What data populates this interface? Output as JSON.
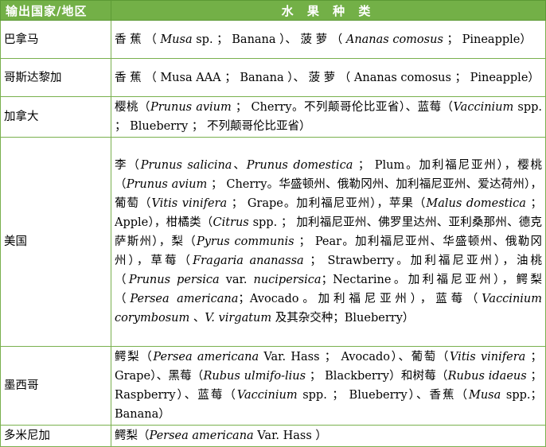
{
  "header": {
    "country_col": "输出国家/地区",
    "fruit_col": "水 果 种 类"
  },
  "rows": [
    {
      "country": "巴拿马",
      "parts": [
        {
          "t": "香 蕉 （ "
        },
        {
          "t": "Musa",
          "i": true
        },
        {
          "t": " sp. ； Banana ）、 菠 萝 （ "
        },
        {
          "t": "Ananas comosus",
          "i": true
        },
        {
          "t": " ； Pineapple）"
        }
      ]
    },
    {
      "country": "哥斯达黎加",
      "parts": [
        {
          "t": "香 蕉 （ Musa AAA ； Banana ）、 菠 萝 （ Ananas comosus ； Pineapple）"
        }
      ]
    },
    {
      "country": "加拿大",
      "parts": [
        {
          "t": "樱桃（"
        },
        {
          "t": "Prunus avium",
          "i": true
        },
        {
          "t": " ； Cherry。不列颠哥伦比亚省）、蓝莓（"
        },
        {
          "t": "Vaccinium",
          "i": true
        },
        {
          "t": " spp. ； Blueberry ； 不列颠哥伦比亚省）"
        }
      ]
    },
    {
      "country": "美国",
      "parts": [
        {
          "t": "李（"
        },
        {
          "t": "Prunus salicina",
          "i": true
        },
        {
          "t": "、"
        },
        {
          "t": "Prunus domestica",
          "i": true
        },
        {
          "t": " ； Plum。加利福尼亚州），樱桃（"
        },
        {
          "t": "Prunus avium",
          "i": true
        },
        {
          "t": " ； Cherry。华盛顿州、俄勒冈州、加利福尼亚州、爱达荷州），葡萄（"
        },
        {
          "t": "Vitis vinifera",
          "i": true
        },
        {
          "t": " ； Grape。加利福尼亚州），苹果（"
        },
        {
          "t": "Malus domestica",
          "i": true
        },
        {
          "t": " ； Apple），柑橘类（"
        },
        {
          "t": "Citrus",
          "i": true
        },
        {
          "t": " spp. ； 加利福尼亚州、佛罗里达州、亚利桑那州、德克萨斯州），梨（"
        },
        {
          "t": "Pyrus communis",
          "i": true
        },
        {
          "t": " ； Pear。加利福尼亚州、华盛顿州、俄勒冈州），草莓（"
        },
        {
          "t": "Fragaria ananassa",
          "i": true
        },
        {
          "t": " ； Strawberry。加利福尼亚州），油桃（"
        },
        {
          "t": "Prunus persica",
          "i": true
        },
        {
          "t": " var. "
        },
        {
          "t": "nucipersica",
          "i": true
        },
        {
          "t": "；Nectarine。加利福尼亚州），鳄梨（"
        },
        {
          "t": "Persea americana",
          "i": true
        },
        {
          "t": "；Avocado。加利福尼亚州），蓝莓（"
        },
        {
          "t": "Vaccinium corymbosum",
          "i": true
        },
        {
          "t": " 、"
        },
        {
          "t": "V. virgatum",
          "i": true
        },
        {
          "t": " 及其杂交种；Blueberry）"
        }
      ]
    },
    {
      "country": "墨西哥",
      "parts": [
        {
          "t": "鳄梨（"
        },
        {
          "t": "Persea americana",
          "i": true
        },
        {
          "t": " Var. Hass ； Avocado）、葡萄（"
        },
        {
          "t": "Vitis vinifera",
          "i": true
        },
        {
          "t": " ； Grape）、黑莓（"
        },
        {
          "t": "Rubus ulmifo-lius",
          "i": true
        },
        {
          "t": " ； Blackberry）和树莓（"
        },
        {
          "t": "Rubus idaeus",
          "i": true
        },
        {
          "t": " ； Raspberry）、蓝莓（"
        },
        {
          "t": "Vaccinium",
          "i": true
        },
        {
          "t": " spp. ； Blueberry）、香蕉（"
        },
        {
          "t": "Musa",
          "i": true
        },
        {
          "t": " spp.；Banana）"
        }
      ]
    },
    {
      "country": "多米尼加",
      "parts": [
        {
          "t": "鳄梨（"
        },
        {
          "t": "Persea americana",
          "i": true
        },
        {
          "t": " Var. Hass ）"
        }
      ]
    }
  ],
  "colors": {
    "header_bg": "#73b047",
    "header_text": "#ffffff",
    "border": "#79b04e"
  }
}
